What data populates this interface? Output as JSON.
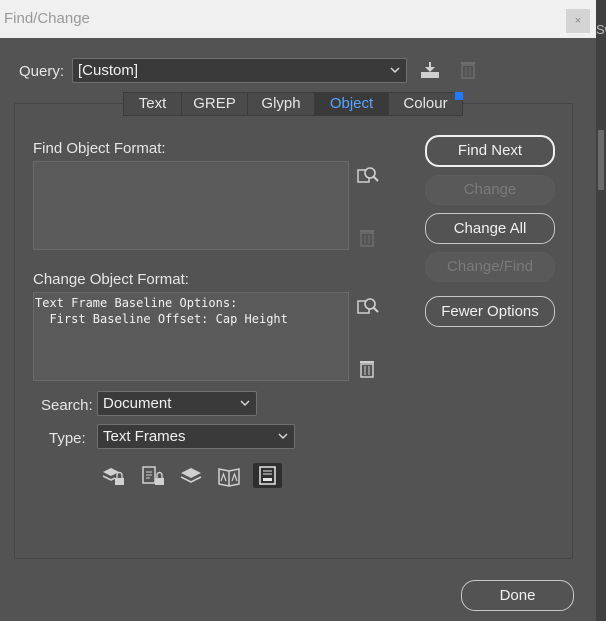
{
  "window": {
    "title": "Find/Change",
    "close_glyph": "×",
    "side_panel_text": "Sw"
  },
  "query": {
    "label": "Query:",
    "value": "[Custom]"
  },
  "tabs": [
    {
      "label": "Text"
    },
    {
      "label": "GREP"
    },
    {
      "label": "Glyph"
    },
    {
      "label": "Object",
      "active": true
    },
    {
      "label": "Colour"
    }
  ],
  "find": {
    "label": "Find Object Format:",
    "text": ""
  },
  "change": {
    "label": "Change Object Format:",
    "text": "Text Frame Baseline Options:\n  First Baseline Offset: Cap Height"
  },
  "search": {
    "label": "Search:",
    "value": "Document"
  },
  "type": {
    "label": "Type:",
    "value": "Text Frames"
  },
  "buttons": {
    "find_next": "Find Next",
    "change": "Change",
    "change_all": "Change All",
    "change_find": "Change/Find",
    "fewer_options": "Fewer Options",
    "done": "Done"
  },
  "option_icons": [
    "locked-layers-icon",
    "locked-stories-icon",
    "hidden-layers-icon",
    "master-pages-icon",
    "footnotes-icon"
  ],
  "colors": {
    "accent": "#5aa3ff",
    "indicator": "#1e7bff",
    "dialog_bg": "#535353"
  }
}
